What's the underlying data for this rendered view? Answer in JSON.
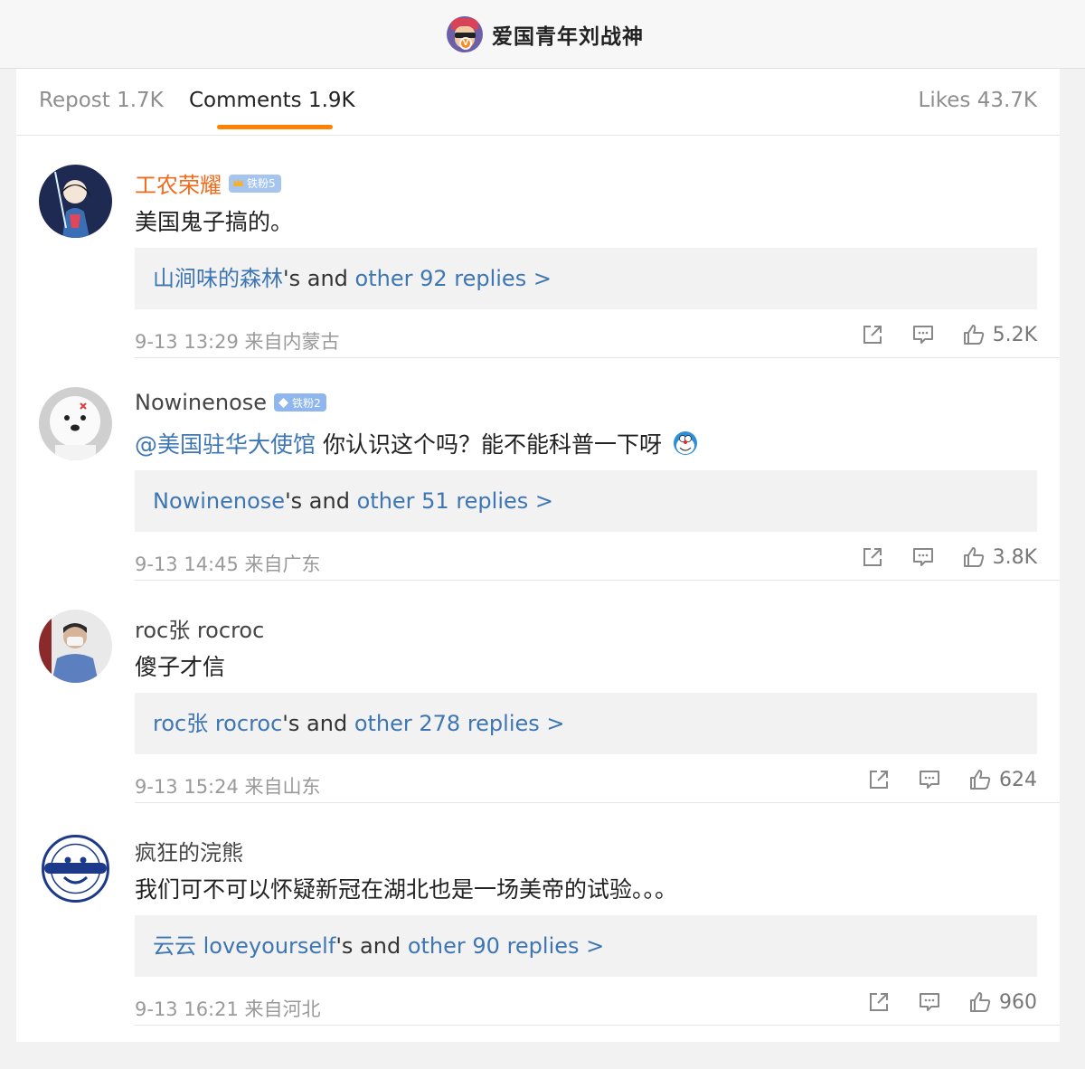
{
  "header": {
    "title": "爱国青年刘战神",
    "verified_mark": "V"
  },
  "tabs": {
    "repost": "Repost 1.7K",
    "comments": "Comments 1.9K",
    "likes": "Likes 43.7K"
  },
  "colors": {
    "accent": "#ff8200",
    "link": "#3e76b3",
    "vip_name": "#f06b1c"
  },
  "comments": [
    {
      "name": "工农荣耀",
      "badge": "铁粉5",
      "badge_icon": "crown-icon",
      "text": "美国鬼子搞的。",
      "reply_user": "山涧味的森林",
      "reply_mid": "'s and ",
      "reply_link": "other 92 replies >",
      "meta": "9-13 13:29  来自内蒙古",
      "likes": "5.2K"
    },
    {
      "name": "Nowinenose",
      "badge": "铁粉2",
      "badge_icon": "diamond-icon",
      "mention": "@美国驻华大使馆",
      "text": " 你认识这个吗？能不能科普一下呀",
      "emoji_icon": "doraemon-emoji-icon",
      "reply_user": "Nowinenose",
      "reply_mid": "'s and ",
      "reply_link": "other 51 replies >",
      "meta": "9-13 14:45  来自广东",
      "likes": "3.8K"
    },
    {
      "name": "roc张 rocroc",
      "text": "傻子才信",
      "reply_user": "roc张 rocroc",
      "reply_mid": "'s and ",
      "reply_link": "other 278 replies >",
      "meta": "9-13 15:24  来自山东",
      "likes": "624"
    },
    {
      "name": "疯狂的浣熊",
      "text": "我们可不可以怀疑新冠在湖北也是一场美帝的试验。。。",
      "reply_user": "云云 loveyourself",
      "reply_mid": "'s and ",
      "reply_link": "other 90 replies >",
      "meta": "9-13 16:21  来自河北",
      "likes": "960"
    }
  ]
}
